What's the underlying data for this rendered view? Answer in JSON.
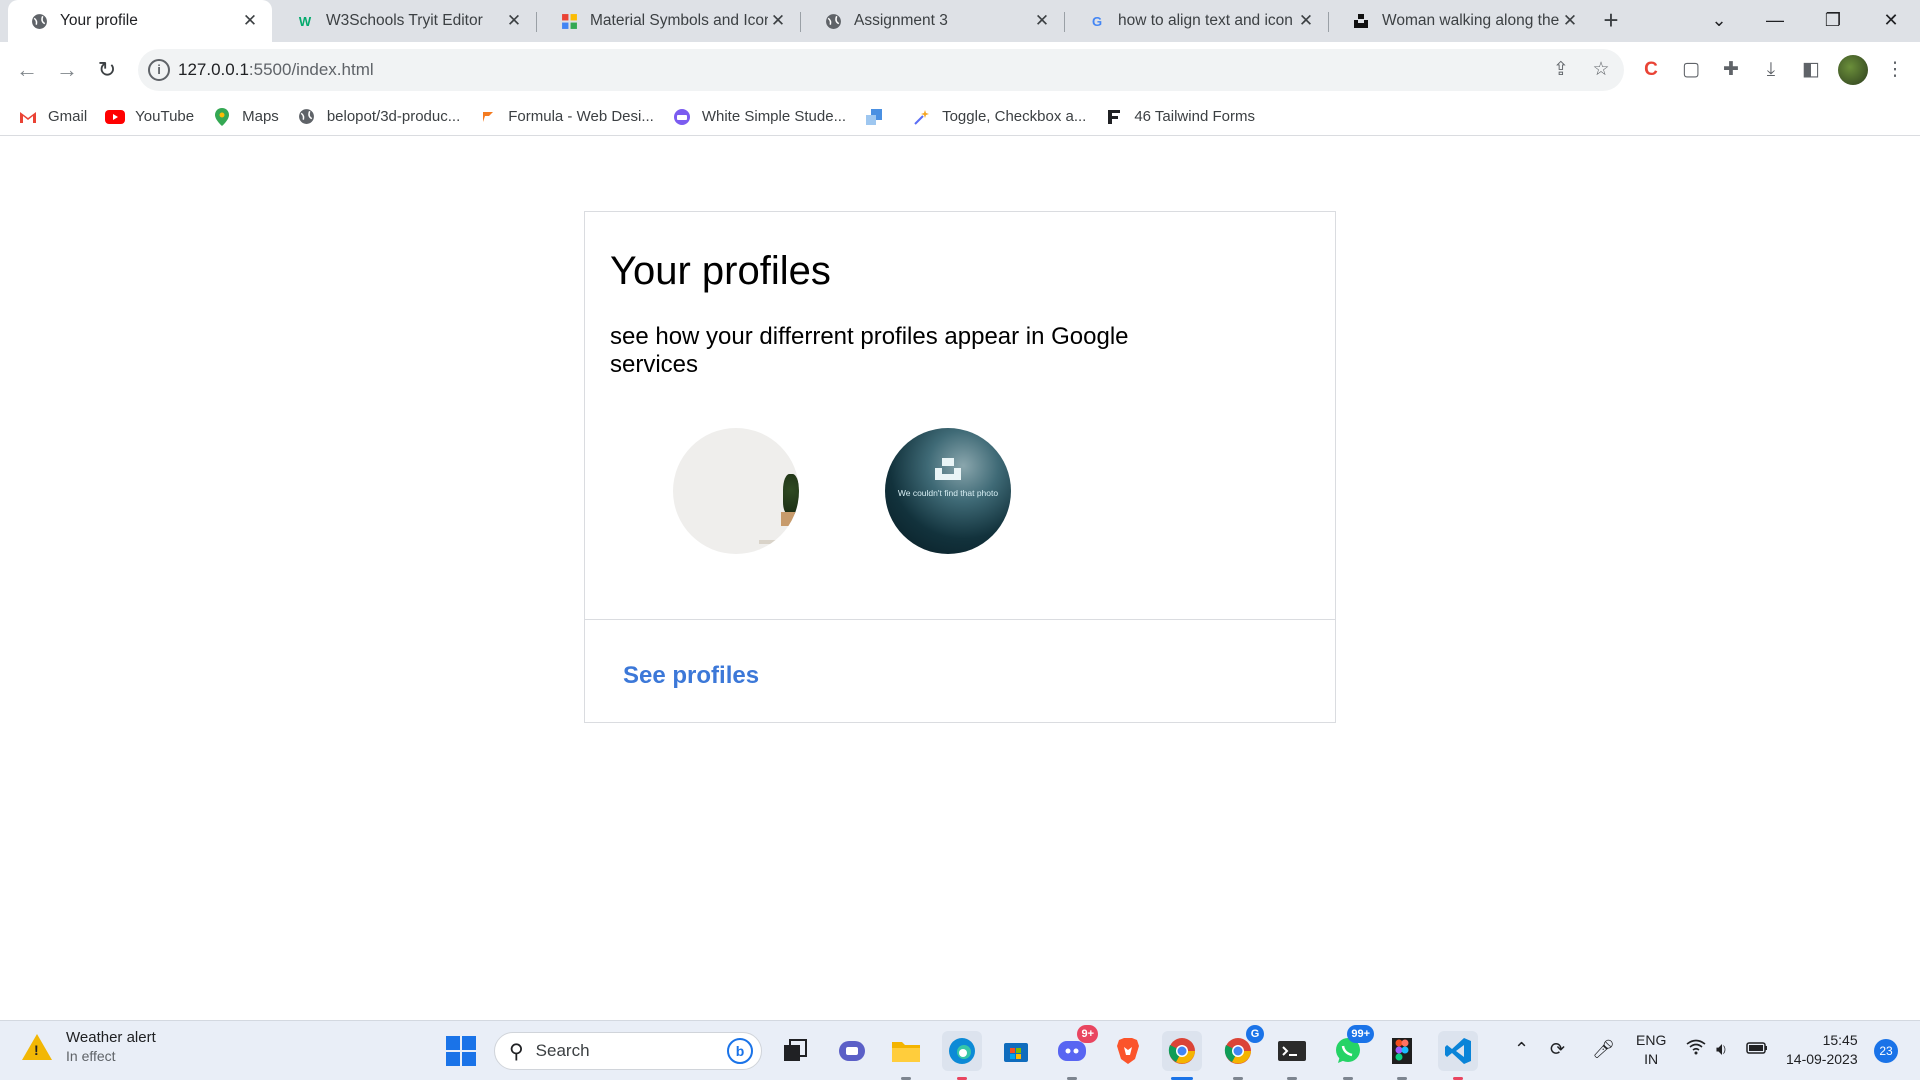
{
  "browser": {
    "tabs": [
      {
        "title": "Your profile",
        "icon": "globe-icon",
        "active": true
      },
      {
        "title": "W3Schools Tryit Editor",
        "icon": "w3schools-icon"
      },
      {
        "title": "Material Symbols and Icons",
        "icon": "material-icon"
      },
      {
        "title": "Assignment 3",
        "icon": "globe-icon"
      },
      {
        "title": "how to align text and icon i",
        "icon": "google-icon"
      },
      {
        "title": "Woman walking along the",
        "icon": "unsplash-icon"
      }
    ],
    "url_host": "127.0.0.1",
    "url_path": ":5500/index.html",
    "bookmarks": [
      {
        "label": "Gmail",
        "icon": "gmail-icon"
      },
      {
        "label": "YouTube",
        "icon": "youtube-icon"
      },
      {
        "label": "Maps",
        "icon": "maps-icon"
      },
      {
        "label": "belopot/3d-produc...",
        "icon": "globe-icon"
      },
      {
        "label": "Formula - Web Desi...",
        "icon": "formula-icon"
      },
      {
        "label": "White Simple Stude...",
        "icon": "canva-icon"
      },
      {
        "label": "",
        "icon": "bookmark-square-icon"
      },
      {
        "label": "Toggle, Checkbox a...",
        "icon": "sparkle-icon"
      },
      {
        "label": "46 Tailwind Forms",
        "icon": "f-icon"
      }
    ]
  },
  "page": {
    "title": "Your profiles",
    "subtitle": "see how your differrent profiles appear in Google services",
    "photo2_message": "We couldn't find that photo",
    "link": "See profiles"
  },
  "taskbar": {
    "weather_title": "Weather alert",
    "weather_sub": "In effect",
    "search_label": "Search",
    "discord_badge": "9+",
    "whatsapp_badge": "99+",
    "chrome_profile_badge": "G",
    "lang_line1": "ENG",
    "lang_line2": "IN",
    "time": "15:45",
    "date": "14-09-2023",
    "notifications": "23"
  }
}
